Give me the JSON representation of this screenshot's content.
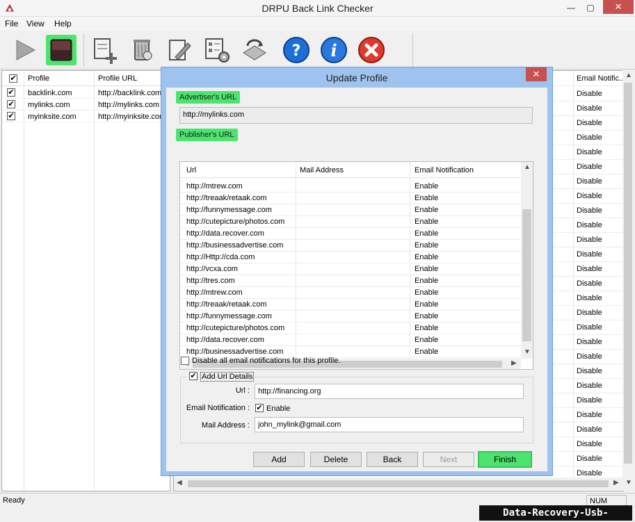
{
  "window": {
    "title": "DRPU Back Link Checker",
    "minimize": "—",
    "maximize": "▢",
    "close": "✕"
  },
  "menu": [
    "File",
    "View",
    "Help"
  ],
  "toolbar_icons": [
    "play-icon",
    "stop-icon",
    "add-profile-icon",
    "delete-profile-icon",
    "edit-profile-icon",
    "settings-icon",
    "refresh-icon",
    "help-icon",
    "info-icon",
    "exit-icon"
  ],
  "left_table": {
    "headers": [
      "Profile",
      "Profile URL"
    ],
    "rows": [
      {
        "checked": true,
        "profile": "backlink.com",
        "url": "http://backlink.com"
      },
      {
        "checked": true,
        "profile": "mylinks.com",
        "url": "http://mylinks.com"
      },
      {
        "checked": true,
        "profile": "myinksite.com",
        "url": "http://myinksite.com"
      }
    ]
  },
  "right_table": {
    "header": "Email Notific...",
    "rows": [
      "Disable",
      "Disable",
      "Disable",
      "Disable",
      "Disable",
      "Disable",
      "Disable",
      "Disable",
      "Disable",
      "Disable",
      "Disable",
      "Disable",
      "Disable",
      "Disable",
      "Disable",
      "Disable",
      "Disable",
      "Disable",
      "Disable",
      "Disable",
      "Disable",
      "Disable",
      "Disable",
      "Disable",
      "Disable",
      "Disable",
      "Disable",
      "Disable"
    ]
  },
  "status": {
    "text": "Ready",
    "num": "NUM"
  },
  "watermark": "Data-Recovery-Usb-Drive.com",
  "dialog": {
    "title": "Update Profile",
    "close": "✕",
    "advertiser_label": "Advertiser's URL",
    "advertiser_value": "http://mylinks.com",
    "publisher_label": "Publisher's URL",
    "grid_headers": [
      "Url",
      "Mail Address",
      "Email Notification"
    ],
    "grid_rows": [
      {
        "url": "http://mtrew.com",
        "mail": "",
        "notify": "Enable"
      },
      {
        "url": "http://treaak/retaak.com",
        "mail": "",
        "notify": "Enable"
      },
      {
        "url": "http://funnymessage.com",
        "mail": "",
        "notify": "Enable"
      },
      {
        "url": "http://cutepicture/photos.com",
        "mail": "",
        "notify": "Enable"
      },
      {
        "url": "http://data.recover.com",
        "mail": "",
        "notify": "Enable"
      },
      {
        "url": "http://businessadvertise.com",
        "mail": "",
        "notify": "Enable"
      },
      {
        "url": "http://Http://cda.com",
        "mail": "",
        "notify": "Enable"
      },
      {
        "url": "http://vcxa.com",
        "mail": "",
        "notify": "Enable"
      },
      {
        "url": "http://tres.com",
        "mail": "",
        "notify": "Enable"
      },
      {
        "url": "http://mtrew.com",
        "mail": "",
        "notify": "Enable"
      },
      {
        "url": "http://treaak/retaak.com",
        "mail": "",
        "notify": "Enable"
      },
      {
        "url": "http://funnymessage.com",
        "mail": "",
        "notify": "Enable"
      },
      {
        "url": "http://cutepicture/photos.com",
        "mail": "",
        "notify": "Enable"
      },
      {
        "url": "http://data.recover.com",
        "mail": "",
        "notify": "Enable"
      },
      {
        "url": "http://businessadvertise.com",
        "mail": "",
        "notify": "Enable"
      }
    ],
    "disable_all_label": "Disable all email notifications for this profile.",
    "disable_all_checked": false,
    "add_url_details_label": "Add Url Details",
    "add_url_details_checked": true,
    "url_label": "Url :",
    "url_value": "http://financing.org",
    "email_notification_label": "Email Notification :",
    "enable_label": "Enable",
    "enable_checked": true,
    "mail_label": "Mail Address :",
    "mail_value": "john_mylink@gmail.com",
    "buttons": {
      "add": "Add",
      "delete": "Delete",
      "back": "Back",
      "next": "Next",
      "finish": "Finish"
    }
  },
  "colors": {
    "green_highlight": "#4ce46e",
    "dialog_frame": "#9dc3ee",
    "close_red": "#c75050"
  }
}
